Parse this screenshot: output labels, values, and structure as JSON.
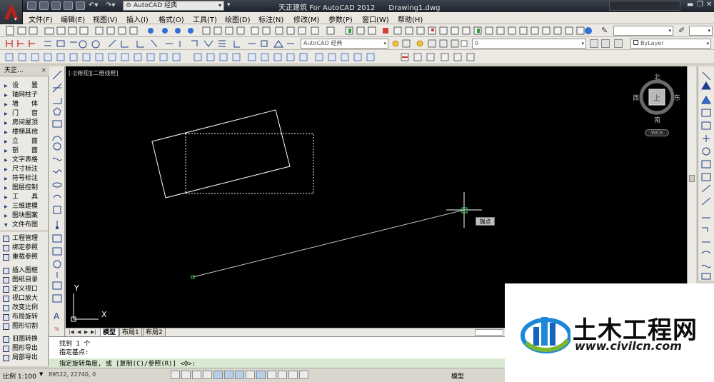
{
  "app": {
    "title": "天正建筑 For AutoCAD 2012      Drawing1.dwg",
    "workspace": "AutoCAD 经典"
  },
  "menu": [
    "文件(F)",
    "编辑(E)",
    "视图(V)",
    "插入(I)",
    "格式(O)",
    "工具(T)",
    "绘图(D)",
    "标注(N)",
    "修改(M)",
    "参数(P)",
    "窗口(W)",
    "帮助(H)"
  ],
  "toolbar2": {
    "workspace_combo": "AutoCAD 经典",
    "layer_combo": "0",
    "linetype_combo": "ByLayer"
  },
  "tianzheng_panel": {
    "title": "天正...",
    "items": [
      "设　　置",
      "轴网柱子",
      "墙　　体",
      "门　　窗",
      "房间屋顶",
      "楼梯其他",
      "立　　面",
      "剖　　面",
      "文字表格",
      "尺寸标注",
      "符号标注",
      "图层控制",
      "工　　具",
      "三维建模",
      "图块图案",
      "文件布图"
    ],
    "sub_items": [
      "工程管理",
      "绑定参照",
      "重载参照",
      "插入图框",
      "图纸目录",
      "定义视口",
      "视口放大",
      "改变比例",
      "布局旋转",
      "图形切割",
      "旧图转换",
      "图形导出",
      "局部导出"
    ]
  },
  "viewport": {
    "label": "[-][俯视][二维线框]",
    "compass": {
      "north": "北",
      "south": "南",
      "east": "东",
      "west": "西",
      "center": "上"
    },
    "wcs": "WCS",
    "snap_tooltip": "端点",
    "ucs_y": "Y",
    "ucs_x": "X"
  },
  "layout_tabs": [
    "模型",
    "布局1",
    "布局2"
  ],
  "command": {
    "lines": [
      "找到 1 个",
      "指定基点:"
    ],
    "current": "指定旋转角度, 或 [复制(C)/参照(R)] <0>:"
  },
  "status": {
    "scale": "比例 1:100",
    "coords": "89522, 22740, 0",
    "model": "模型"
  },
  "watermark": {
    "title": "土木工程网",
    "url": "www.civilcn.com"
  },
  "colors": {
    "canvas_bg": "#000000",
    "entity": "#ffffff",
    "snap_marker": "#2ecc40",
    "command_highlight": "#d9e8d0"
  }
}
